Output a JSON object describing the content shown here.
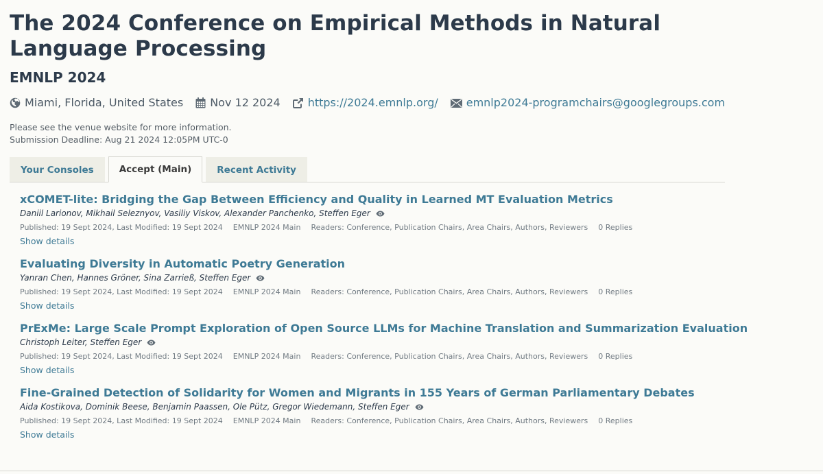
{
  "venue": {
    "title": "The 2024 Conference on Empirical Methods in Natural Language Processing",
    "short_name": "EMNLP 2024",
    "location": "Miami, Florida, United States",
    "date": "Nov 12 2024",
    "website": "https://2024.emnlp.org/",
    "email": "emnlp2024-programchairs@googlegroups.com",
    "instructions": "Please see the venue website for more information.",
    "deadline": "Submission Deadline: Aug 21 2024 12:05PM UTC-0"
  },
  "icons": {
    "location": "globe-icon",
    "date": "calendar-icon",
    "website": "external-link-icon",
    "email": "envelope-icon",
    "readers": "eye-icon"
  },
  "tabs": [
    {
      "label": "Your Consoles",
      "active": false
    },
    {
      "label": "Accept (Main)",
      "active": true
    },
    {
      "label": "Recent Activity",
      "active": false
    }
  ],
  "notes": [
    {
      "title": "xCOMET-lite: Bridging the Gap Between Efficiency and Quality in Learned MT Evaluation Metrics",
      "authors": "Daniil Larionov, Mikhail Seleznyov, Vasiliy Viskov, Alexander Panchenko, Steffen Eger",
      "dates": "Published: 19 Sept 2024, Last Modified: 19 Sept 2024",
      "venue": "EMNLP 2024 Main",
      "readers": "Readers: Conference, Publication Chairs, Area Chairs, Authors, Reviewers",
      "replies": "0 Replies",
      "details_label": "Show details"
    },
    {
      "title": "Evaluating Diversity in Automatic Poetry Generation",
      "authors": "Yanran Chen, Hannes Gröner, Sina Zarrieß, Steffen Eger",
      "dates": "Published: 19 Sept 2024, Last Modified: 19 Sept 2024",
      "venue": "EMNLP 2024 Main",
      "readers": "Readers: Conference, Publication Chairs, Area Chairs, Authors, Reviewers",
      "replies": "0 Replies",
      "details_label": "Show details"
    },
    {
      "title": "PrExMe: Large Scale Prompt Exploration of Open Source LLMs for Machine Translation and Summarization Evaluation",
      "authors": "Christoph Leiter, Steffen Eger",
      "dates": "Published: 19 Sept 2024, Last Modified: 19 Sept 2024",
      "venue": "EMNLP 2024 Main",
      "readers": "Readers: Conference, Publication Chairs, Area Chairs, Authors, Reviewers",
      "replies": "0 Replies",
      "details_label": "Show details"
    },
    {
      "title": "Fine-Grained Detection of Solidarity for Women and Migrants in 155 Years of German Parliamentary Debates",
      "authors": "Aida Kostikova, Dominik Beese, Benjamin Paassen, Ole Pütz, Gregor Wiedemann, Steffen Eger",
      "dates": "Published: 19 Sept 2024, Last Modified: 19 Sept 2024",
      "venue": "EMNLP 2024 Main",
      "readers": "Readers: Conference, Publication Chairs, Area Chairs, Authors, Reviewers",
      "replies": "0 Replies",
      "details_label": "Show details"
    }
  ],
  "colors": {
    "link": "#3e7a95",
    "heading": "#2c3a4a",
    "background": "#fbfbf8",
    "tab_inactive": "#eeeee6"
  }
}
